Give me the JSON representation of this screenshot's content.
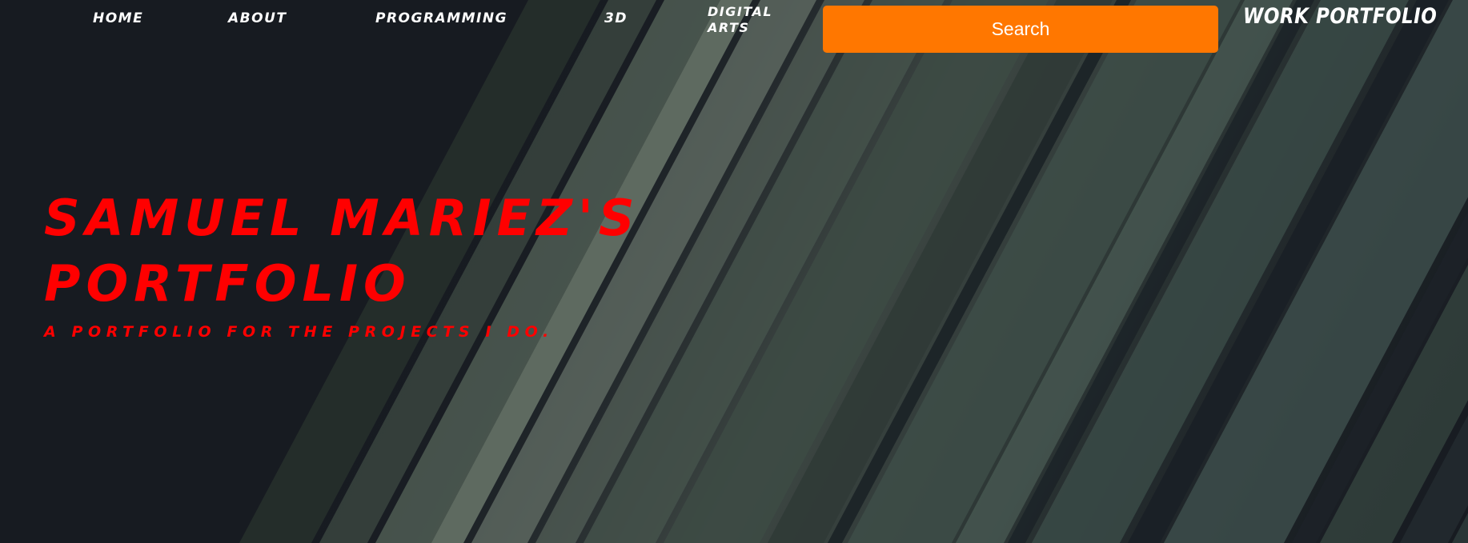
{
  "nav": {
    "items": [
      {
        "label": "HOME"
      },
      {
        "label": "ABOUT"
      },
      {
        "label": "PROGRAMMING"
      },
      {
        "label": "3D"
      },
      {
        "label": "DIGITAL ARTS"
      }
    ]
  },
  "search": {
    "placeholder": "Search"
  },
  "brand": {
    "label": "WORK PORTFOLIO"
  },
  "hero": {
    "title": "SAMUEL MARIEZ'S PORTFOLIO",
    "subtitle": "A PORTFOLIO FOR THE PROJECTS I DO."
  },
  "colors": {
    "accent_red": "#ff0000",
    "search_orange": "#ff7700",
    "background_dark": "#171b21",
    "stripe_gray_green": "#4a5a52"
  }
}
